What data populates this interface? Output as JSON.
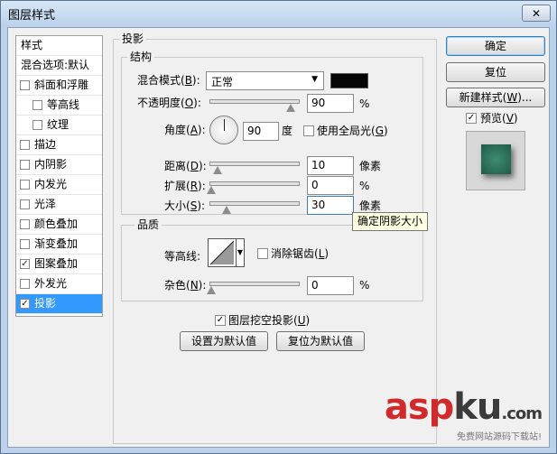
{
  "window": {
    "title": "图层样式",
    "close_glyph": "✕"
  },
  "style_list": {
    "header": "样式",
    "blend_options": "混合选项:默认",
    "items": [
      {
        "label": "斜面和浮雕",
        "checked": false
      },
      {
        "label": "等高线",
        "checked": false
      },
      {
        "label": "纹理",
        "checked": false
      },
      {
        "label": "描边",
        "checked": false
      },
      {
        "label": "内阴影",
        "checked": false
      },
      {
        "label": "内发光",
        "checked": false
      },
      {
        "label": "光泽",
        "checked": false
      },
      {
        "label": "颜色叠加",
        "checked": false
      },
      {
        "label": "渐变叠加",
        "checked": false
      },
      {
        "label": "图案叠加",
        "checked": true
      },
      {
        "label": "外发光",
        "checked": false
      },
      {
        "label": "投影",
        "checked": true,
        "selected": true
      }
    ]
  },
  "drop_shadow": {
    "section_title": "投影",
    "structure": {
      "title": "结构",
      "blend_mode_label": "混合模式(",
      "blend_mode_key": "B",
      "blend_mode_value": "正常",
      "shadow_color": "#050505",
      "opacity_label": "不透明度(",
      "opacity_key": "O",
      "opacity_value": "90",
      "opacity_level_percent": 90,
      "percent": "%",
      "angle_label": "角度(",
      "angle_key": "A",
      "angle_value": "90",
      "angle_unit": "度",
      "global_light_label": "使用全局光(",
      "global_light_key": "G",
      "global_light_checked": false,
      "distance_label": "距离(",
      "distance_key": "D",
      "distance_value": "10",
      "distance_unit": "像素",
      "spread_label": "扩展(",
      "spread_key": "R",
      "spread_value": "0",
      "size_label": "大小(",
      "size_key": "S",
      "size_value": "30",
      "size_unit": "像素",
      "colon_close": "):",
      "close_paren": ")"
    },
    "quality": {
      "title": "品质",
      "contour_label": "等高线:",
      "anti_alias_label": "消除锯齿(",
      "anti_alias_key": "L",
      "anti_alias_checked": false,
      "noise_label": "杂色(",
      "noise_key": "N",
      "noise_value": "0",
      "percent": "%"
    },
    "knockout_label": "图层挖空投影(",
    "knockout_key": "U",
    "knockout_checked": true,
    "make_default": "设置为默认值",
    "reset_default": "复位为默认值"
  },
  "tooltip": "确定阴影大小",
  "buttons": {
    "ok": "确定",
    "reset": "复位",
    "new_style": "新建样式(",
    "new_style_key": "W",
    "new_style_suffix": ")...",
    "preview_label": "预览(",
    "preview_key": "V",
    "preview_checked": true
  },
  "watermark": {
    "brand_a": "asp",
    "brand_b": "ku",
    "domain": ".com",
    "sub": "免费网站源码下载站!"
  }
}
